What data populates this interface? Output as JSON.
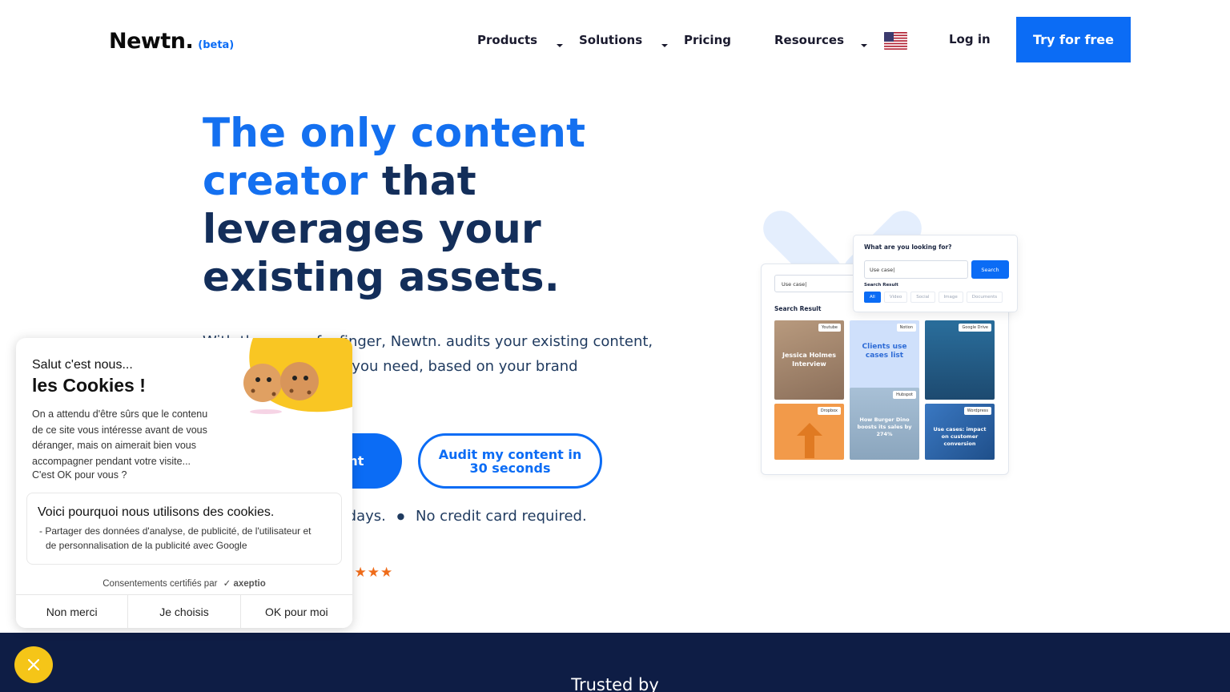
{
  "header": {
    "logo_text": "Newtn.",
    "logo_beta": "(beta)",
    "nav": [
      {
        "label": "Products"
      },
      {
        "label": "Solutions"
      },
      {
        "label": "Pricing"
      },
      {
        "label": "Resources"
      }
    ],
    "language_icon": "us-flag-icon",
    "login_label": "Log in",
    "try_label": "Try for free"
  },
  "hero": {
    "title_blue": "The only content creator",
    "title_dark": " that leverages your existing assets.",
    "subtitle": "With the snap of a finger, Newtn. audits your existing content, and creates the one you need, based on your brand",
    "cta_primary": "Create content",
    "cta_secondary": "Audit my content in 30 seconds",
    "trial_text": "Try it for free for 14 days.",
    "trial_sep": "●",
    "no_card_text": "No credit card required.",
    "rating_stars": "★★★★★"
  },
  "illustration": {
    "popup_title": "What are you looking for?",
    "popup_input": "Use case|",
    "popup_search": "Search",
    "popup_label": "Search Result",
    "popup_tabs": [
      "All",
      "Video",
      "Social",
      "Image",
      "Documents"
    ],
    "back_input": "Use case|",
    "back_label": "Search Result",
    "tiles": [
      {
        "tag": "Youtube",
        "text": "Jessica Holmes Interview"
      },
      {
        "tag": "Notion",
        "text": "Clients use cases list"
      },
      {
        "tag": "Google Drive",
        "text": ""
      },
      {
        "tag": "Dropbox",
        "text": ""
      },
      {
        "tag": "Hubspot",
        "text": "How Burger Dino boosts its sales by 274%"
      },
      {
        "tag": "Wordpress",
        "text": "Use cases: impact on customer conversion"
      }
    ]
  },
  "cookie": {
    "greeting": "Salut c'est nous...",
    "title": "les Cookies !",
    "body": "On a attendu d'être sûrs que le contenu de ce site vous intéresse avant de vous déranger, mais on aimerait bien vous accompagner pendant votre visite...",
    "question": "C'est OK pour vous ?",
    "box_title": "Voici pourquoi nous utilisons des cookies.",
    "box_item": "- Partager des données d'analyse, de publicité, de l'utilisateur et de personnalisation de la publicité avec Google",
    "certified": "Consentements certifiés par",
    "brand": "axeptio",
    "btn_no": "Non merci",
    "btn_choose": "Je choisis",
    "btn_ok": "OK pour moi"
  },
  "band": {
    "trusted": "Trusted by"
  },
  "colors": {
    "primary": "#0b6cf5",
    "navy": "#132e5a",
    "band": "#0e1d45",
    "star": "#ef6c1a",
    "fab": "#f5c518"
  }
}
